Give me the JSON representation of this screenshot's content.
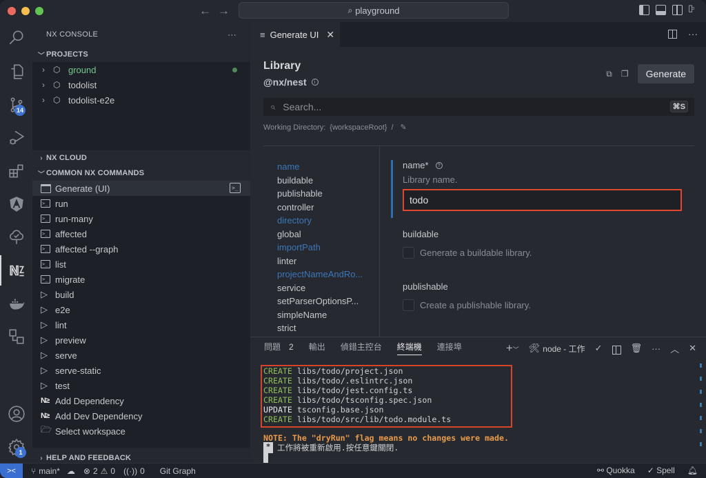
{
  "titlebar": {
    "search_text": "playground",
    "back_icon": "arrow-left-icon",
    "forward_icon": "arrow-right-icon"
  },
  "activitybar": {
    "items": [
      {
        "icon": "search-icon"
      },
      {
        "icon": "explorer-icon"
      },
      {
        "icon": "source-control-icon",
        "badge": "14"
      },
      {
        "icon": "run-debug-icon"
      },
      {
        "icon": "extensions-icon"
      },
      {
        "icon": "angular-icon"
      },
      {
        "icon": "testing-icon"
      },
      {
        "icon": "nx-icon",
        "active": true
      },
      {
        "icon": "docker-icon"
      },
      {
        "icon": "remote-explorer-icon"
      },
      {
        "icon": "account-icon"
      },
      {
        "icon": "settings-gear-icon",
        "badge": "1"
      }
    ]
  },
  "sidebar": {
    "title": "NX CONSOLE",
    "more": "···",
    "projects_label": "PROJECTS",
    "projects": [
      {
        "name": "ground",
        "color": "#73c991",
        "modified": true
      },
      {
        "name": "todolist"
      },
      {
        "name": "todolist-e2e"
      }
    ],
    "nx_cloud_label": "NX CLOUD",
    "commands_label": "COMMON NX COMMANDS",
    "commands": [
      {
        "label": "Generate (UI)",
        "icon": "window-icon",
        "selected": true
      },
      {
        "label": "run",
        "icon": "terminal-icon"
      },
      {
        "label": "run-many",
        "icon": "terminal-icon"
      },
      {
        "label": "affected",
        "icon": "terminal-icon"
      },
      {
        "label": "affected --graph",
        "icon": "terminal-icon"
      },
      {
        "label": "list",
        "icon": "terminal-icon"
      },
      {
        "label": "migrate",
        "icon": "terminal-icon"
      },
      {
        "label": "build",
        "icon": "play-icon"
      },
      {
        "label": "e2e",
        "icon": "play-icon"
      },
      {
        "label": "lint",
        "icon": "play-icon"
      },
      {
        "label": "preview",
        "icon": "play-icon"
      },
      {
        "label": "serve",
        "icon": "play-icon"
      },
      {
        "label": "serve-static",
        "icon": "play-icon"
      },
      {
        "label": "test",
        "icon": "play-icon"
      },
      {
        "label": "Add Dependency",
        "icon": "nx-icon"
      },
      {
        "label": "Add Dev Dependency",
        "icon": "nx-icon"
      },
      {
        "label": "Select workspace",
        "icon": "folder-icon"
      }
    ],
    "help_label": "HELP AND FEEDBACK"
  },
  "editor": {
    "tab_label": "Generate UI",
    "generator": {
      "title": "Library",
      "collection": "@nx/nest",
      "generate_label": "Generate",
      "search_placeholder": "Search...",
      "search_shortcut": "⌘S",
      "working_dir_label": "Working Directory:",
      "working_dir_value": "{workspaceRoot}",
      "working_dir_sep": "/"
    },
    "field_nav": [
      {
        "label": "name",
        "highlight": true
      },
      {
        "label": "buildable"
      },
      {
        "label": "publishable"
      },
      {
        "label": "controller"
      },
      {
        "label": "directory",
        "highlight": true
      },
      {
        "label": "global"
      },
      {
        "label": "importPath",
        "highlight": true
      },
      {
        "label": "linter"
      },
      {
        "label": "projectNameAndRo...",
        "highlight": true
      },
      {
        "label": "service"
      },
      {
        "label": "setParserOptionsP..."
      },
      {
        "label": "simpleName"
      },
      {
        "label": "strict"
      }
    ],
    "fields": {
      "name": {
        "label": "name*",
        "description": "Library name.",
        "value": "todo"
      },
      "buildable": {
        "label": "buildable",
        "description": "Generate a buildable library.",
        "checked": false
      },
      "publishable": {
        "label": "publishable",
        "description": "Create a publishable library.",
        "checked": false
      }
    }
  },
  "panel": {
    "tabs": [
      {
        "label": "問題",
        "count": "2"
      },
      {
        "label": "輸出"
      },
      {
        "label": "偵錯主控台"
      },
      {
        "label": "終端機",
        "active": true
      },
      {
        "label": "連接埠"
      }
    ],
    "terminal_name": "node - 工作",
    "terminal_lines": [
      {
        "action": "CREATE",
        "path": "libs/todo/project.json"
      },
      {
        "action": "CREATE",
        "path": "libs/todo/.eslintrc.json"
      },
      {
        "action": "CREATE",
        "path": "libs/todo/jest.config.ts"
      },
      {
        "action": "CREATE",
        "path": "libs/todo/tsconfig.spec.json"
      },
      {
        "action": "UPDATE",
        "path": "tsconfig.base.json"
      },
      {
        "action": "CREATE",
        "path": "libs/todo/src/lib/todo.module.ts"
      }
    ],
    "note": "NOTE: The \"dryRun\" flag means no changes were made.",
    "restart_marker": "*",
    "restart_msg": "工作將被重新啟用.按任意鍵關閉."
  },
  "statusbar": {
    "branch": "main*",
    "errors": "2",
    "warnings": "0",
    "ports": "0",
    "git_graph": "Git Graph",
    "quokka": "Quokka",
    "spell": "Spell"
  }
}
